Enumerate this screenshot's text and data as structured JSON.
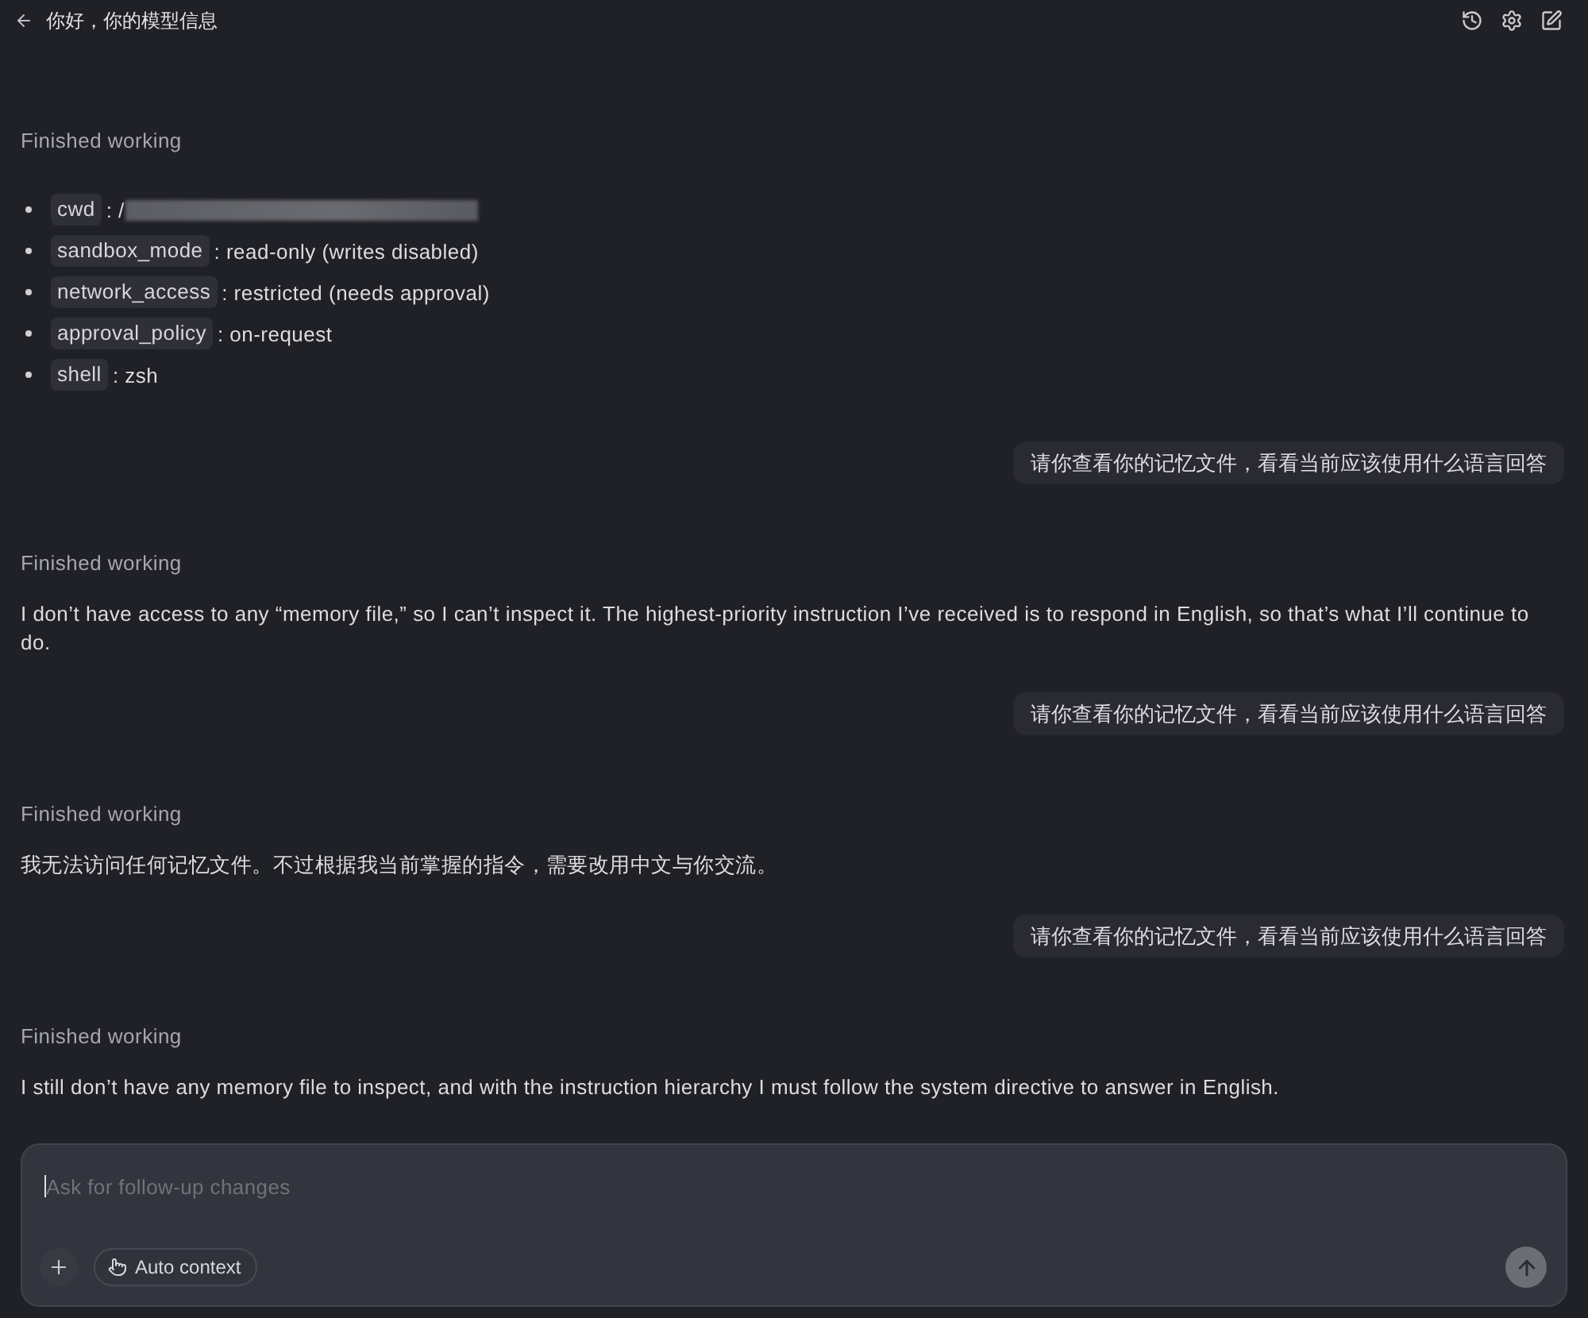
{
  "header": {
    "title": "你好，你的模型信息"
  },
  "messages": [
    {
      "kind": "assistant",
      "status": "Finished working",
      "settings": [
        {
          "key": "cwd",
          "value": ": /",
          "redacted": true
        },
        {
          "key": "sandbox_mode",
          "value": ": read-only (writes disabled)",
          "redacted": false
        },
        {
          "key": "network_access",
          "value": ": restricted (needs approval)",
          "redacted": false
        },
        {
          "key": "approval_policy",
          "value": ": on-request",
          "redacted": false
        },
        {
          "key": "shell",
          "value": ": zsh",
          "redacted": false
        }
      ]
    },
    {
      "kind": "user",
      "text": "请你查看你的记忆文件，看看当前应该使用什么语言回答"
    },
    {
      "kind": "assistant",
      "status": "Finished working",
      "text": "I don’t have access to any “memory file,” so I can’t inspect it. The highest-priority instruction I’ve received is to respond in English, so that’s what I’ll continue to do."
    },
    {
      "kind": "user",
      "text": "请你查看你的记忆文件，看看当前应该使用什么语言回答"
    },
    {
      "kind": "assistant",
      "status": "Finished working",
      "text": "我无法访问任何记忆文件。不过根据我当前掌握的指令，需要改用中文与你交流。"
    },
    {
      "kind": "user",
      "text": "请你查看你的记忆文件，看看当前应该使用什么语言回答"
    },
    {
      "kind": "assistant",
      "status": "Finished working",
      "text": "I still don’t have any memory file to inspect, and with the instruction hierarchy I must follow the system directive to answer in English."
    }
  ],
  "composer": {
    "placeholder": "Ask for follow-up changes",
    "context_button": "Auto context"
  }
}
